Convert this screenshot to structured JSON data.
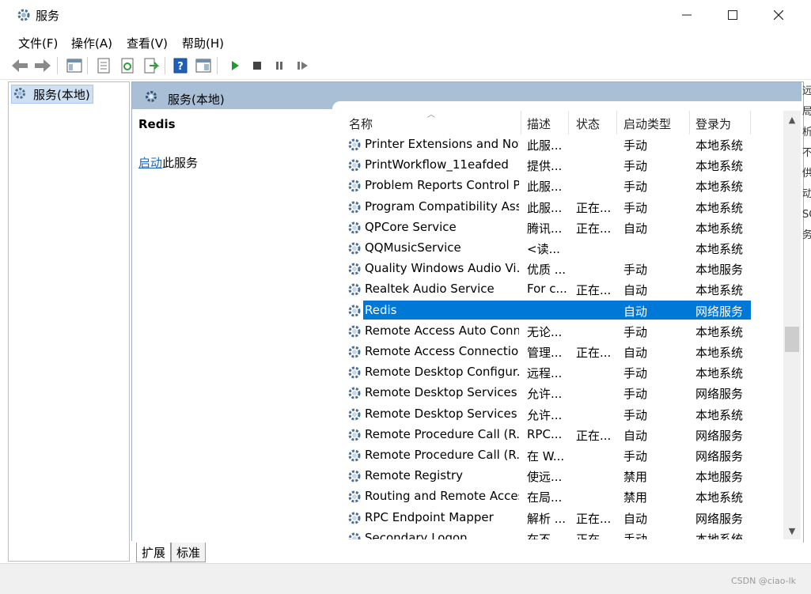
{
  "window": {
    "title": "服务"
  },
  "menu": [
    "文件(F)",
    "操作(A)",
    "查看(V)",
    "帮助(H)"
  ],
  "toolbar_icons": [
    "back-arrow-icon",
    "forward-arrow-icon",
    "console-tree-icon",
    "properties-icon",
    "refresh-icon",
    "export-list-icon",
    "help-icon",
    "view-icon",
    "start-service-icon",
    "stop-service-icon",
    "pause-service-icon",
    "restart-service-icon"
  ],
  "tree": {
    "root": "服务(本地)"
  },
  "header": {
    "label": "服务(本地)"
  },
  "detail": {
    "service_name": "Redis",
    "start_link": "启动",
    "start_suffix": "此服务"
  },
  "columns": {
    "name": "名称",
    "description": "描述",
    "status": "状态",
    "startup": "启动类型",
    "logon": "登录为"
  },
  "services": [
    {
      "name": "Printer Extensions and Noti...",
      "desc": "此服...",
      "status": "",
      "startup": "手动",
      "logon": "本地系统"
    },
    {
      "name": "PrintWorkflow_11eafded",
      "desc": "提供...",
      "status": "",
      "startup": "手动",
      "logon": "本地系统"
    },
    {
      "name": "Problem Reports Control P...",
      "desc": "此服...",
      "status": "",
      "startup": "手动",
      "logon": "本地系统"
    },
    {
      "name": "Program Compatibility Assi...",
      "desc": "此服...",
      "status": "正在...",
      "startup": "手动",
      "logon": "本地系统"
    },
    {
      "name": "QPCore Service",
      "desc": "腾讯...",
      "status": "正在...",
      "startup": "自动",
      "logon": "本地系统"
    },
    {
      "name": "QQMusicService",
      "desc": "<读...",
      "status": "",
      "startup": "",
      "logon": "本地系统"
    },
    {
      "name": "Quality Windows Audio Vi...",
      "desc": "优质 ...",
      "status": "",
      "startup": "手动",
      "logon": "本地服务"
    },
    {
      "name": "Realtek Audio Service",
      "desc": "For c...",
      "status": "正在...",
      "startup": "自动",
      "logon": "本地系统"
    },
    {
      "name": "Redis",
      "desc": "",
      "status": "",
      "startup": "自动",
      "logon": "网络服务",
      "selected": true
    },
    {
      "name": "Remote Access Auto Conn...",
      "desc": "无论...",
      "status": "",
      "startup": "手动",
      "logon": "本地系统"
    },
    {
      "name": "Remote Access Connectio...",
      "desc": "管理...",
      "status": "正在...",
      "startup": "自动",
      "logon": "本地系统"
    },
    {
      "name": "Remote Desktop Configur...",
      "desc": "远程...",
      "status": "",
      "startup": "手动",
      "logon": "本地系统"
    },
    {
      "name": "Remote Desktop Services",
      "desc": "允许...",
      "status": "",
      "startup": "手动",
      "logon": "网络服务"
    },
    {
      "name": "Remote Desktop Services ...",
      "desc": "允许...",
      "status": "",
      "startup": "手动",
      "logon": "本地系统"
    },
    {
      "name": "Remote Procedure Call (R...",
      "desc": "RPC...",
      "status": "正在...",
      "startup": "自动",
      "logon": "网络服务"
    },
    {
      "name": "Remote Procedure Call (R...",
      "desc": "在 W...",
      "status": "",
      "startup": "手动",
      "logon": "网络服务"
    },
    {
      "name": "Remote Registry",
      "desc": "使远...",
      "status": "",
      "startup": "禁用",
      "logon": "本地服务"
    },
    {
      "name": "Routing and Remote Access",
      "desc": "在局...",
      "status": "",
      "startup": "禁用",
      "logon": "本地系统"
    },
    {
      "name": "RPC Endpoint Mapper",
      "desc": "解析 ...",
      "status": "正在...",
      "startup": "自动",
      "logon": "网络服务"
    },
    {
      "name": "Secondary Logon",
      "desc": "在不...",
      "status": "正在...",
      "startup": "手动",
      "logon": "本地系统"
    }
  ],
  "tabs": {
    "extended": "扩展",
    "standard": "标准"
  },
  "status": {
    "watermark": "CSDN @ciao-lk"
  },
  "peek_chars": [
    "远",
    "局",
    "析",
    "不",
    "供",
    "动",
    "SC",
    "务"
  ],
  "colors": {
    "selection": "#0078d7",
    "header_band": "#a9bfd6",
    "link": "#1565c0"
  }
}
